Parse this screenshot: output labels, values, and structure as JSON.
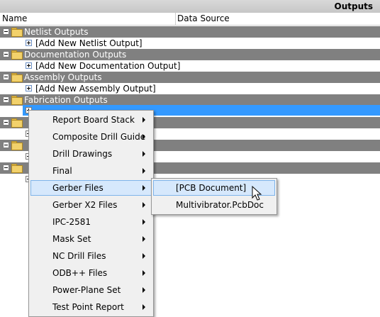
{
  "panel": {
    "title": "Outputs"
  },
  "columns": {
    "name": "Name",
    "data_source": "Data Source"
  },
  "groups": [
    {
      "label": "Netlist Outputs",
      "child": "[Add New Netlist Output]"
    },
    {
      "label": "Documentation Outputs",
      "child": "[Add New Documentation Output]"
    },
    {
      "label": "Assembly Outputs",
      "child": "[Add New Assembly Output]"
    },
    {
      "label": "Fabrication Outputs",
      "child": ""
    },
    {
      "label": "",
      "child": ""
    },
    {
      "label": "",
      "child": ""
    },
    {
      "label": "",
      "child": ""
    }
  ],
  "context_menu": {
    "items": [
      {
        "label": "Report Board Stack",
        "has_submenu": true
      },
      {
        "label": "Composite Drill Guide",
        "has_submenu": true
      },
      {
        "label": "Drill Drawings",
        "has_submenu": true
      },
      {
        "label": "Final",
        "has_submenu": true
      },
      {
        "label": "Gerber Files",
        "has_submenu": true,
        "highlighted": true
      },
      {
        "label": "Gerber X2 Files",
        "has_submenu": true
      },
      {
        "label": "IPC-2581",
        "has_submenu": true
      },
      {
        "label": "Mask Set",
        "has_submenu": true
      },
      {
        "label": "NC Drill Files",
        "has_submenu": true
      },
      {
        "label": "ODB++ Files",
        "has_submenu": true
      },
      {
        "label": "Power-Plane Set",
        "has_submenu": true
      },
      {
        "label": "Test Point Report",
        "has_submenu": true
      }
    ]
  },
  "submenu": {
    "items": [
      {
        "label": "[PCB Document]",
        "highlighted": true
      },
      {
        "label": "Multivibrator.PcbDoc"
      }
    ]
  },
  "colors": {
    "group_row": "#808080",
    "selection": "#3399ff",
    "menu_highlight": "#d6e8fc",
    "menu_highlight_border": "#7eb4ea"
  }
}
